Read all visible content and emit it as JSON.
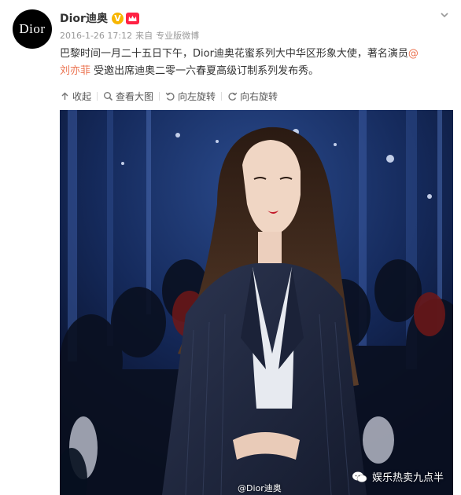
{
  "post": {
    "avatar_text": "Dior",
    "username": "Dior迪奥",
    "verified_badge": "V",
    "date": "2016-1-26 17:12",
    "source_prefix": "来自",
    "source": "专业版微博",
    "text_part1": "巴黎时间一月二十五日下午，Dior迪奥花蜜系列大中华区形象大使，著名演员",
    "mention_line1": "@",
    "mention_line2": "刘亦菲",
    "text_part2": " 受邀出席迪奥二零一六春夏高级订制系列发布秀。"
  },
  "toolbar": {
    "collapse": "收起",
    "view_large": "查看大图",
    "rotate_left": "向左旋转",
    "rotate_right": "向右旋转"
  },
  "image": {
    "watermark_right": "娱乐热卖九点半",
    "watermark_bottom": "@Dior迪奥"
  },
  "colors": {
    "link": "#eb7350",
    "verified": "#f7b500",
    "member_badge": "#ff2244",
    "photo_background": "#0d1836"
  },
  "icons": {
    "expand": "chevron-down-icon",
    "collapse": "arrow-up-icon",
    "view_large": "magnifier-icon",
    "rotate_left": "rotate-left-icon",
    "rotate_right": "rotate-right-icon",
    "watermark": "chat-bubble-icon"
  }
}
